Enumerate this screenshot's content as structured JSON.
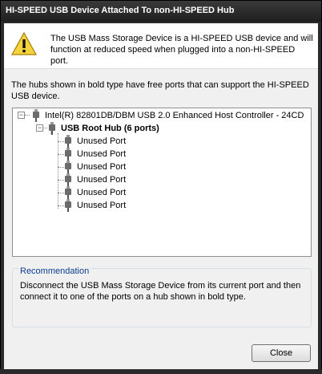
{
  "window": {
    "title": "HI-SPEED USB Device Attached To non-HI-SPEED Hub"
  },
  "header": {
    "icon": "warning-icon",
    "message": "The USB Mass Storage Device is a HI-SPEED USB device and will function at reduced speed when plugged into a non-HI-SPEED port."
  },
  "info_text": "The hubs shown in bold type have free ports that can support the HI-SPEED USB device.",
  "tree": {
    "controller": "Intel(R) 82801DB/DBM USB 2.0 Enhanced Host Controller - 24CD",
    "root_hub": "USB Root Hub (6 ports)",
    "ports": [
      "Unused Port",
      "Unused Port",
      "Unused Port",
      "Unused Port",
      "Unused Port",
      "Unused Port"
    ]
  },
  "recommendation": {
    "label": "Recommendation",
    "text": "Disconnect the USB Mass Storage Device from its current port and then connect it to one of the ports on a hub shown in bold type."
  },
  "buttons": {
    "close": "Close"
  }
}
